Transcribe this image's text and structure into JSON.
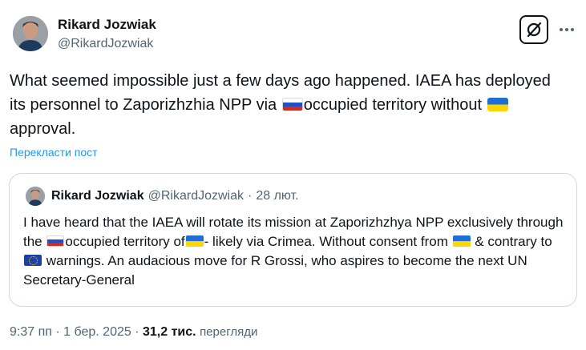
{
  "author": {
    "name": "Rikard Jozwiak",
    "handle": "@RikardJozwiak"
  },
  "tweet": {
    "part1": "What seemed impossible just a few days ago happened. IAEA has deployed its personnel to Zaporizhzhia NPP via ",
    "part2": "occupied territory without ",
    "part3": " approval."
  },
  "translate_label": "Перекласти пост",
  "quote": {
    "name": "Rikard Jozwiak",
    "handle": "@RikardJozwiak",
    "separator": "·",
    "date": "28 лют.",
    "part1": "I have heard that the IAEA will rotate its mission at Zaporizhzhya NPP exclusively through the ",
    "part2": "occupied territory of",
    "part3": "- likely via Crimea. Without consent from ",
    "part4": " & contrary to ",
    "part5": " warnings. An audacious move for R Grossi, who aspires to become the next UN Secretary-General"
  },
  "meta": {
    "time": "9:37 пп",
    "separator": "·",
    "date": "1 бер. 2025",
    "views_count": "31,2 тис.",
    "views_label": "перегляди"
  },
  "icons": {
    "grok": "grok-icon",
    "more": "more-horizontal-icon",
    "flags": [
      "flag-russia-icon",
      "flag-ukraine-icon",
      "flag-eu-icon"
    ]
  }
}
